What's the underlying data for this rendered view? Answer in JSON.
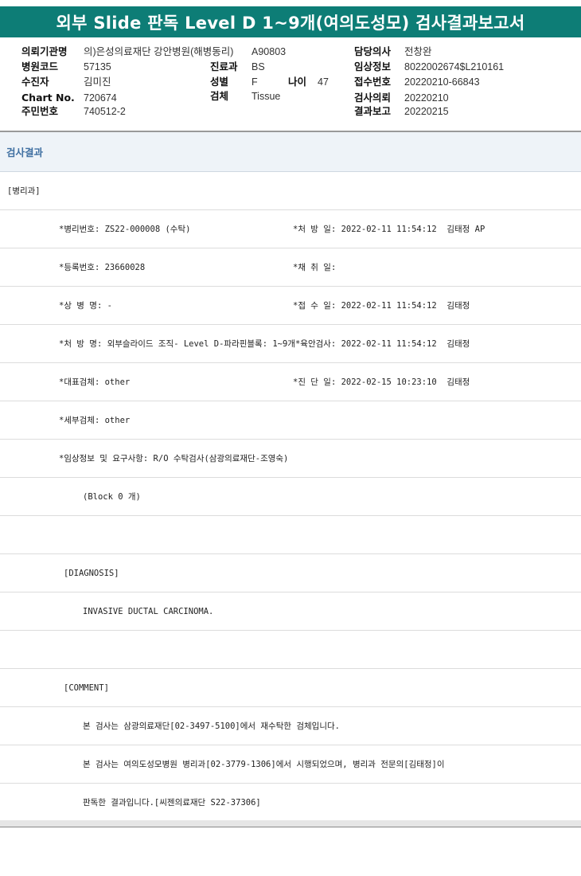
{
  "title": "외부 Slide 판독 Level D 1~9개(여의도성모) 검사결과보고서",
  "info": {
    "institution_label": "의뢰기관명",
    "institution": "의)은성의료재단 강안병원(해병동리)",
    "institution_code": "A90803",
    "doctor_label": "담당의사",
    "doctor": "전창완",
    "hospital_code_label": "병원코드",
    "hospital_code": "57135",
    "dept_label": "진료과",
    "dept": "BS",
    "clinical_label": "임상정보",
    "clinical": "8022002674$L210161",
    "patient_label": "수진자",
    "patient": "김미진",
    "sex_label": "성별",
    "sex": "F",
    "age_label": "나이",
    "age": "47",
    "receipt_label": "접수번호",
    "receipt": "20220210-66843",
    "chart_label": "Chart No.",
    "chart": "720674",
    "specimen_label": "검체",
    "specimen": "Tissue",
    "request_label": "검사의뢰",
    "request": "20220210",
    "resident_label": "주민번호",
    "resident": "740512-2",
    "report_label": "결과보고",
    "report": "20220215"
  },
  "section_title": "검사결과",
  "rows": {
    "dept": "[병리과]",
    "r1a": "*병리번호: ZS22-000008 (수탁)",
    "r1b": "*처 방 일: 2022-02-11 11:54:12  김태정 AP",
    "r2a": "*등록번호: 23660028",
    "r2b": "*채 취 일:",
    "r3a": "*상 병 명: -",
    "r3b": "*접 수 일: 2022-02-11 11:54:12  김태정",
    "r4": "*처 방 명: 외부슬라이드 조직- Level D-파라핀블록: 1~9개*육안검사: 2022-02-11 11:54:12  김태정",
    "r5a": "*대표검체: other",
    "r5b": "*진 단 일: 2022-02-15 10:23:10  김태정",
    "r6": "*세부검체: other",
    "r7": "*임상정보 및 요구사항: R/O 수탁검사(삼광의료재단-조영숙)",
    "r8": "(Block 0 개)",
    "diag_head": "[DIAGNOSIS]",
    "diag": "INVASIVE DUCTAL CARCINOMA.",
    "comment_head": "[COMMENT]",
    "c1": "본 검사는 삼광의료재단[02-3497-5100]에서 재수탁한 검체입니다.",
    "c2": "본 검사는 여의도성모병원 병리과[02-3779-1306]에서 시행되었으며, 병리과 전문의[김태정]이",
    "c3": "판독한 결과입니다.[씨젠의료재단 S22-37306]"
  }
}
